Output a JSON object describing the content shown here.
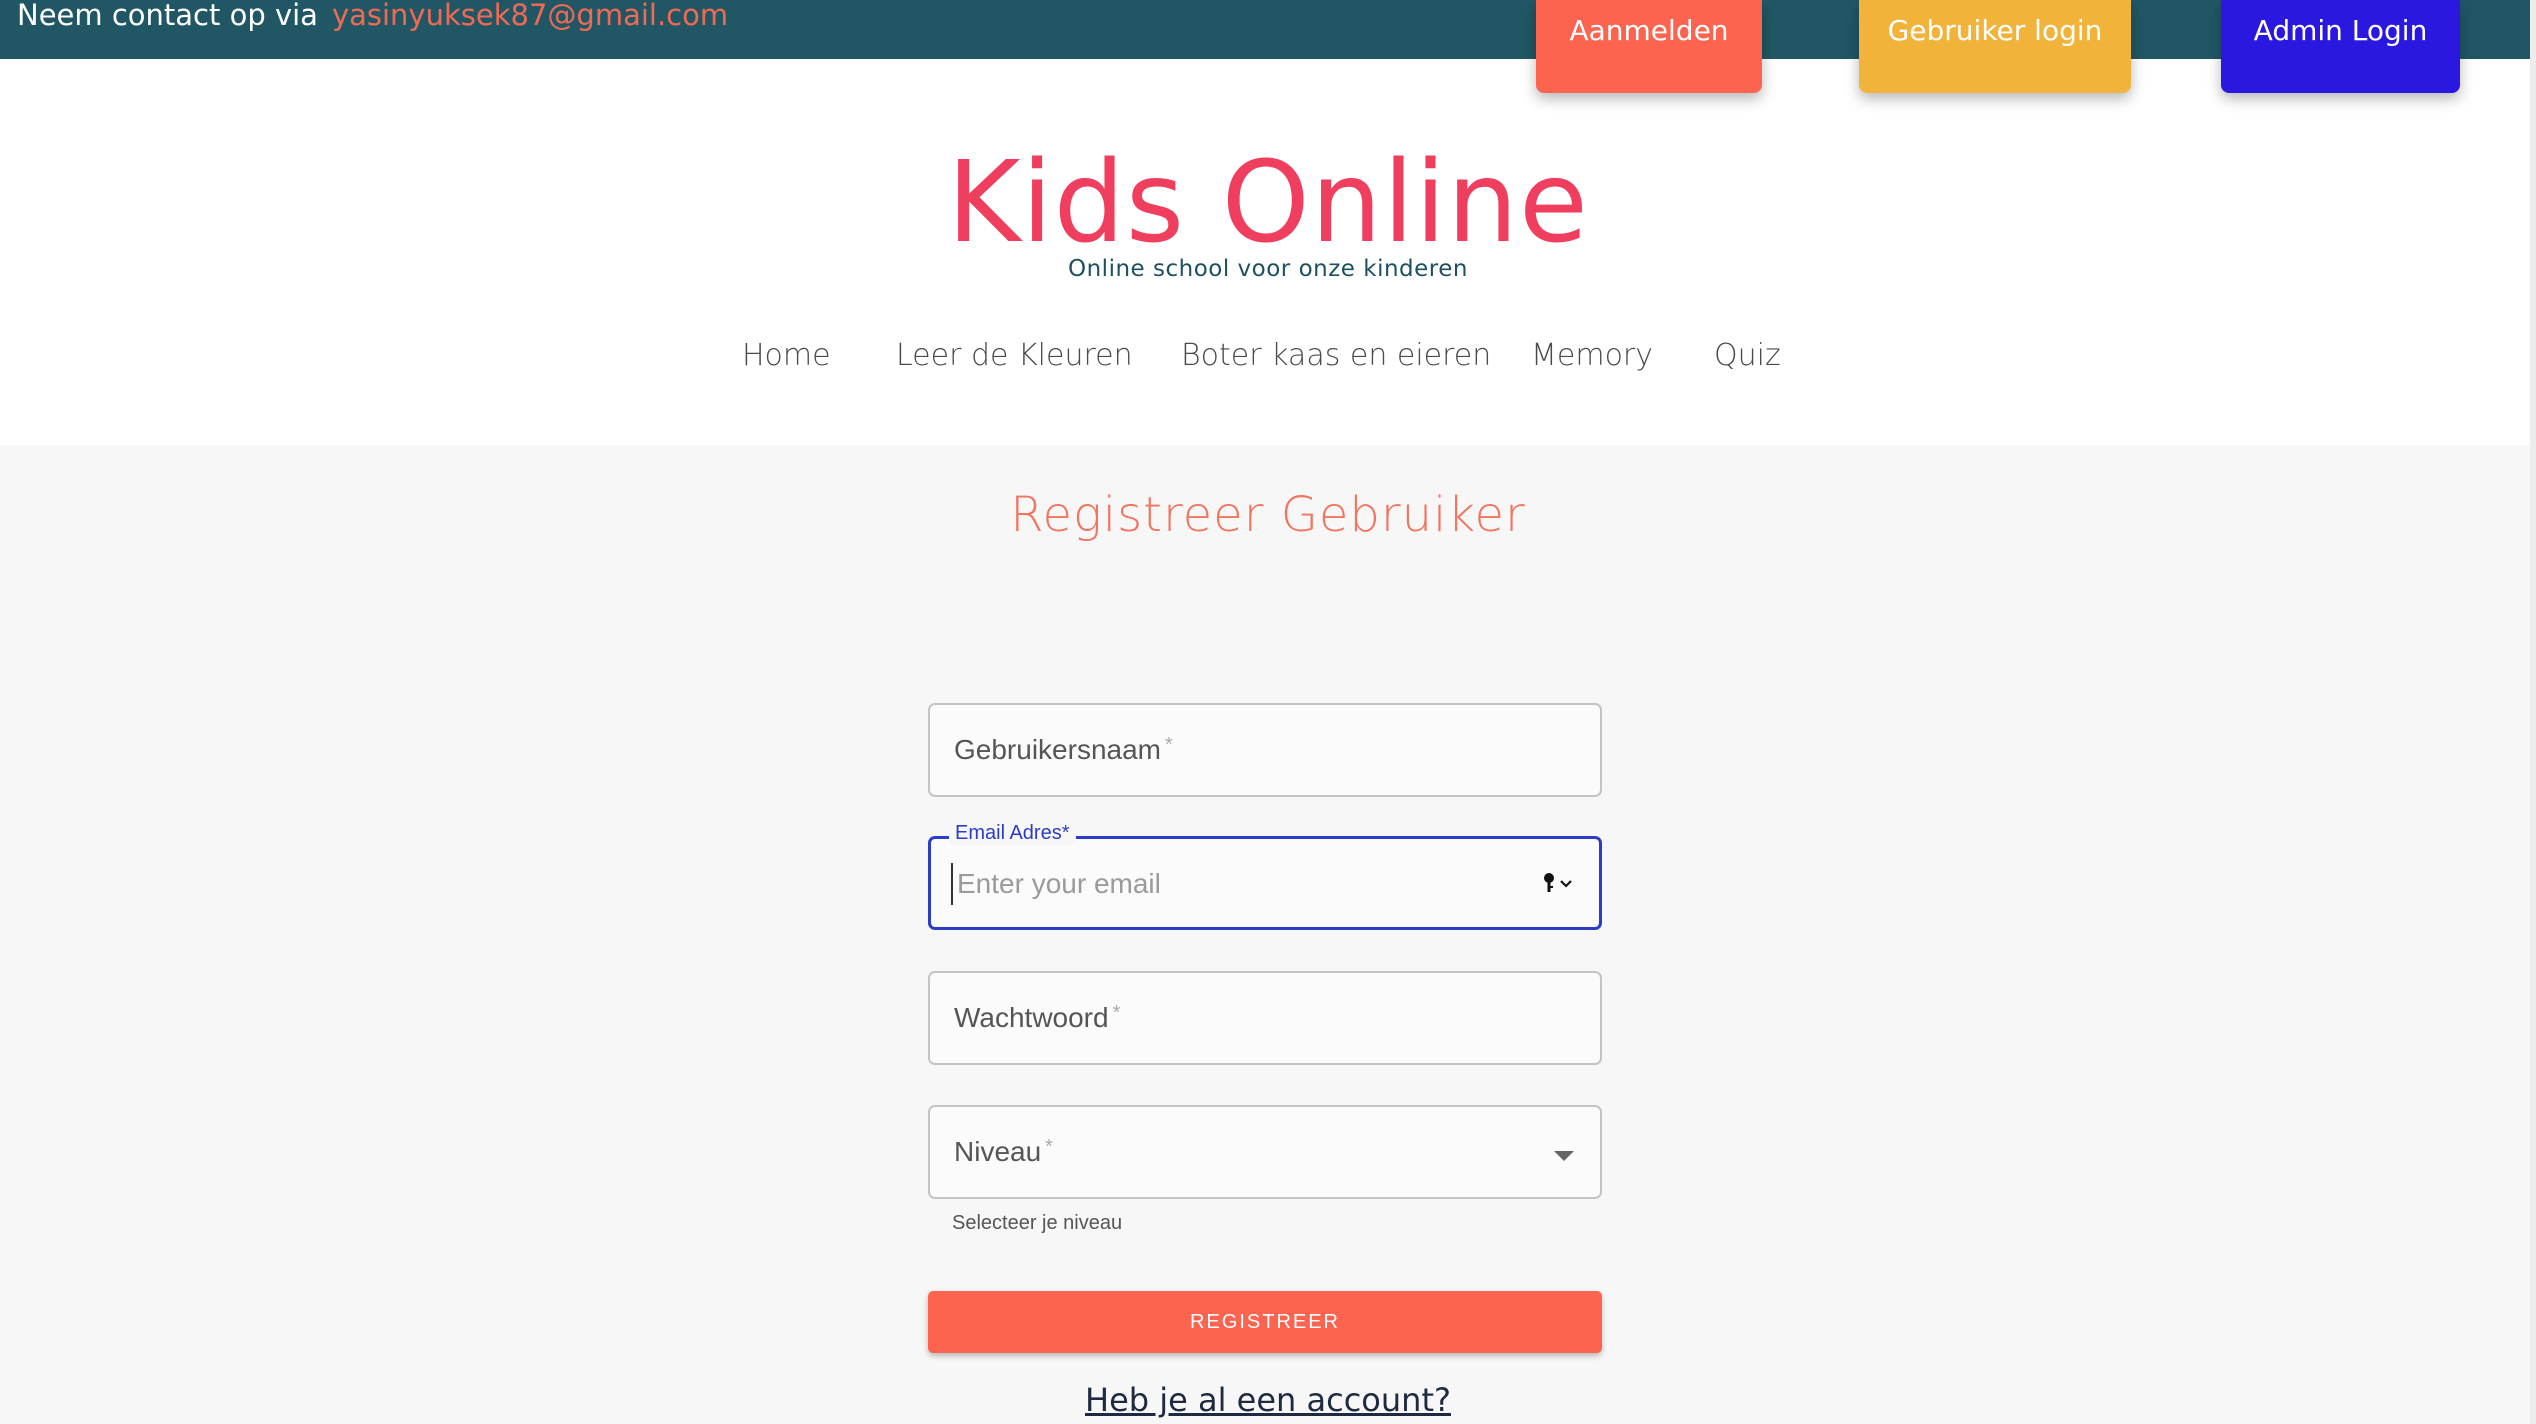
{
  "topbar": {
    "contact_text": "Neem contact op via",
    "email": "yasinyuksek87@gmail.com",
    "buttons": {
      "aanmelden": "Aanmelden",
      "gebruiker_login": "Gebruiker login",
      "admin_login": "Admin Login"
    }
  },
  "brand": {
    "title": "Kids Online",
    "subtitle": "Online school voor onze kinderen"
  },
  "nav": {
    "items": [
      "Home",
      "Leer de Kleuren",
      "Boter kaas en eieren",
      "Memory",
      "Quiz"
    ]
  },
  "form": {
    "title": "Registreer Gebruiker",
    "username_label": "Gebruikersnaam",
    "email_label": "Email Adres",
    "email_placeholder": "Enter your email",
    "password_label": "Wachtwoord",
    "level_label": "Niveau",
    "level_helper": "Selecteer je niveau",
    "required_mark": "*",
    "submit_label": "REGISTREER",
    "account_link": "Heb je al een account?"
  },
  "colors": {
    "topbar": "#215765",
    "brand": "#ef3e5e",
    "aanmelden": "#fd644f",
    "gebruiker": "#f2b33a",
    "admin": "#2b18e0",
    "focus": "#2b3cc7"
  }
}
